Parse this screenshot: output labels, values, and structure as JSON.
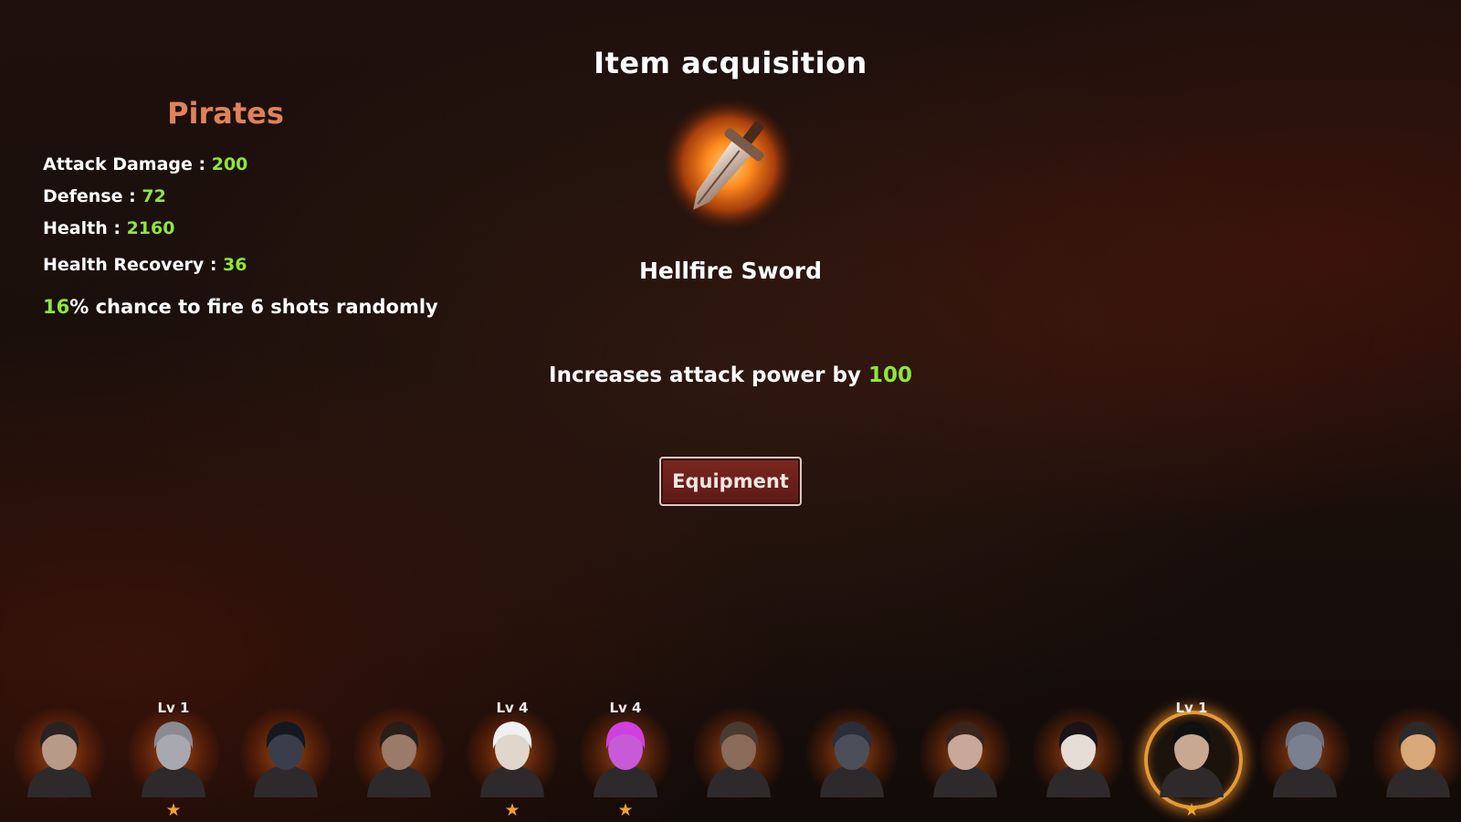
{
  "title": "Item acquisition",
  "hero": {
    "name": "Pirates",
    "stats": [
      {
        "label": "Attack Damage : ",
        "value": "200"
      },
      {
        "label": "Defense : ",
        "value": "72"
      },
      {
        "label": "Health : ",
        "value": "2160"
      },
      {
        "label": "Health Recovery : ",
        "value": "36"
      }
    ],
    "skill": {
      "percent": "16",
      "text": "% chance to fire 6 shots randomly"
    }
  },
  "item": {
    "icon": "sword-icon",
    "name": "Hellfire Sword",
    "desc_prefix": "Increases attack power by ",
    "desc_value": "100"
  },
  "equip_label": "Equipment",
  "roster": [
    {
      "level": "",
      "star": false,
      "selected": false,
      "icon": "bearded-warrior-portrait"
    },
    {
      "level": "Lv 1",
      "star": true,
      "selected": false,
      "icon": "helmeted-knight-portrait"
    },
    {
      "level": "",
      "star": false,
      "selected": false,
      "icon": "hooded-assassin-portrait"
    },
    {
      "level": "",
      "star": false,
      "selected": false,
      "icon": "masked-ranger-portrait"
    },
    {
      "level": "Lv 4",
      "star": true,
      "selected": false,
      "icon": "white-haired-mage-portrait"
    },
    {
      "level": "Lv 4",
      "star": true,
      "selected": false,
      "icon": "pink-haired-ninja-portrait"
    },
    {
      "level": "",
      "star": false,
      "selected": false,
      "icon": "cowboy-gunslinger-portrait"
    },
    {
      "level": "",
      "star": false,
      "selected": false,
      "icon": "armored-golem-portrait"
    },
    {
      "level": "",
      "star": false,
      "selected": false,
      "icon": "dark-haired-archer-portrait"
    },
    {
      "level": "",
      "star": false,
      "selected": false,
      "icon": "pale-witch-portrait"
    },
    {
      "level": "Lv 1",
      "star": true,
      "selected": true,
      "icon": "pirate-captain-portrait"
    },
    {
      "level": "",
      "star": false,
      "selected": false,
      "icon": "armored-soldier-portrait"
    },
    {
      "level": "",
      "star": false,
      "selected": false,
      "icon": "goggled-engineer-portrait"
    }
  ],
  "colors": {
    "highlight": "#8fe63a",
    "hero_name": "#e0825a",
    "star": "#f2a12a",
    "button": "#6a201b"
  }
}
